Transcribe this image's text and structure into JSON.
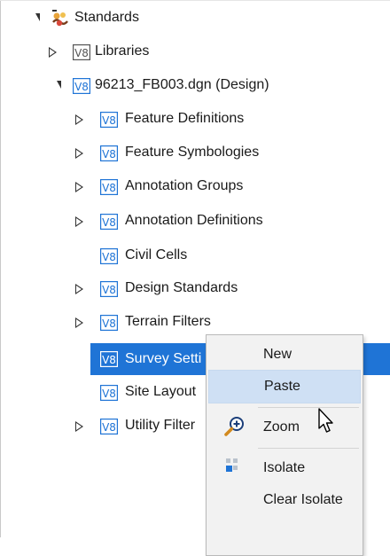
{
  "tree": {
    "root": {
      "label": "Standards",
      "icon": "standards-icon"
    },
    "items": [
      {
        "id": "libraries",
        "label": "Libraries",
        "icon": "v8-icon"
      },
      {
        "id": "dgn",
        "label": "96213_FB003.dgn (Design)",
        "icon": "v8-icon"
      },
      {
        "id": "feature-definitions",
        "label": "Feature Definitions",
        "icon": "v8-icon"
      },
      {
        "id": "feature-symbologies",
        "label": "Feature Symbologies",
        "icon": "v8-icon"
      },
      {
        "id": "annotation-groups",
        "label": "Annotation Groups",
        "icon": "v8-icon"
      },
      {
        "id": "annotation-definitions",
        "label": "Annotation Definitions",
        "icon": "v8-icon"
      },
      {
        "id": "civil-cells",
        "label": "Civil Cells",
        "icon": "v8-icon"
      },
      {
        "id": "design-standards",
        "label": "Design Standards",
        "icon": "v8-icon"
      },
      {
        "id": "terrain-filters",
        "label": "Terrain Filters",
        "icon": "v8-icon"
      },
      {
        "id": "survey-settings",
        "label": "Survey Setti",
        "icon": "v8-icon",
        "selected": true
      },
      {
        "id": "site-layout",
        "label": "Site Layout",
        "icon": "v8-icon"
      },
      {
        "id": "utility-filters",
        "label": "Utility Filter",
        "icon": "v8-icon"
      }
    ]
  },
  "context_menu": {
    "items": [
      {
        "id": "new",
        "label": "New"
      },
      {
        "id": "paste",
        "label": "Paste",
        "hovered": true
      },
      {
        "id": "zoom",
        "label": "Zoom",
        "icon": "zoom-in-icon"
      },
      {
        "id": "isolate",
        "label": "Isolate",
        "icon": "isolate-icon"
      },
      {
        "id": "clear-isolate",
        "label": "Clear Isolate"
      }
    ]
  },
  "colors": {
    "selection": "#1f74d6",
    "menu_background": "#f2f2f2",
    "menu_hover": "#cfe0f4",
    "v8_icon": "#1f74d6"
  }
}
